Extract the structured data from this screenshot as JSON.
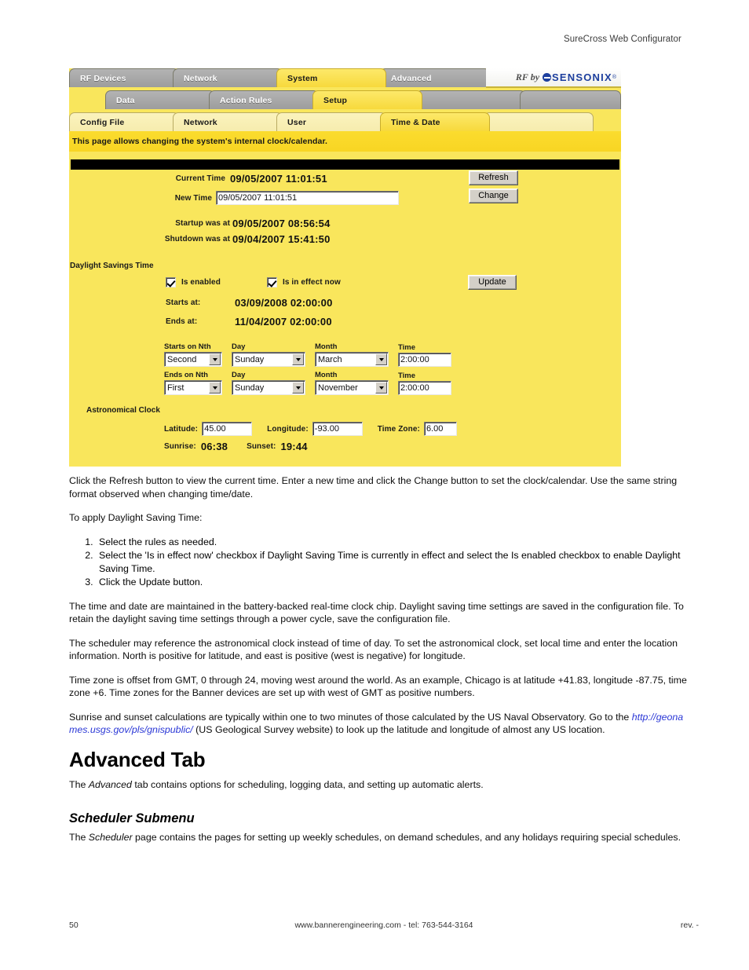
{
  "header": {
    "title": "SureCross Web Configurator"
  },
  "screenshot": {
    "tabs_row1": [
      {
        "label": "RF Devices",
        "state": "inactive"
      },
      {
        "label": "Network",
        "state": "inactive"
      },
      {
        "label": "System",
        "state": "active"
      },
      {
        "label": "Advanced",
        "state": "inactive"
      }
    ],
    "logo": {
      "rf_by": "RF by",
      "brand": "SENSONIX",
      "registered": "®"
    },
    "tabs_row2": [
      {
        "label": "Data",
        "state": "inactive"
      },
      {
        "label": "Action Rules",
        "state": "inactive"
      },
      {
        "label": "Setup",
        "state": "active"
      },
      {
        "label": "",
        "state": "inactive"
      },
      {
        "label": "",
        "state": "inactive"
      }
    ],
    "tabs_row3": [
      {
        "label": "Config File",
        "state": "pale"
      },
      {
        "label": "Network",
        "state": "pale"
      },
      {
        "label": "User",
        "state": "pale"
      },
      {
        "label": "Time & Date",
        "state": "active"
      },
      {
        "label": "",
        "state": "pale"
      }
    ],
    "description": "This page allows changing the system's internal clock/calendar.",
    "clock": {
      "current_time_label": "Current Time",
      "current_time_value": "09/05/2007 11:01:51",
      "new_time_label": "New Time",
      "new_time_value": "09/05/2007 11:01:51",
      "refresh_button": "Refresh",
      "change_button": "Change",
      "startup_label": "Startup was at",
      "startup_value": "09/05/2007 08:56:54",
      "shutdown_label": "Shutdown was at",
      "shutdown_value": "09/04/2007 15:41:50"
    },
    "dst": {
      "section_title": "Daylight Savings Time",
      "is_enabled_label": "Is enabled",
      "is_enabled_checked": true,
      "is_in_effect_label": "Is in effect now",
      "is_in_effect_checked": true,
      "update_button": "Update",
      "starts_at_label": "Starts at:",
      "starts_at_value": "03/09/2008 02:00:00",
      "ends_at_label": "Ends at:",
      "ends_at_value": "11/04/2007 02:00:00",
      "starts_row": {
        "nth_label": "Starts on Nth",
        "nth_value": "Second",
        "day_label": "Day",
        "day_value": "Sunday",
        "month_label": "Month",
        "month_value": "March",
        "time_label": "Time",
        "time_value": "2:00:00"
      },
      "ends_row": {
        "nth_label": "Ends on Nth",
        "nth_value": "First",
        "day_label": "Day",
        "day_value": "Sunday",
        "month_label": "Month",
        "month_value": "November",
        "time_label": "Time",
        "time_value": "2:00:00"
      }
    },
    "astro": {
      "section_title": "Astronomical Clock",
      "latitude_label": "Latitude:",
      "latitude_value": "45.00",
      "longitude_label": "Longitude:",
      "longitude_value": "-93.00",
      "timezone_label": "Time Zone:",
      "timezone_value": "6.00",
      "sunrise_label": "Sunrise:",
      "sunrise_value": "06:38",
      "sunset_label": "Sunset:",
      "sunset_value": "19:44"
    }
  },
  "prose": {
    "p1": "Click the Refresh button to view the current time. Enter a new time and click the Change button to set the clock/calendar. Use the same string format observed when changing time/date.",
    "p2": "To apply Daylight Saving Time:",
    "steps": [
      "Select the rules as needed.",
      "Select the 'Is in effect now' checkbox if Daylight Saving Time is currently in effect and select the Is enabled checkbox to enable Daylight Saving Time.",
      "Click the Update button."
    ],
    "p3": "The time and date are maintained in the battery-backed real-time clock chip. Daylight saving time settings are saved in the configuration file. To retain the daylight saving time settings through a power cycle, save the configuration file.",
    "p4": "The scheduler may reference the astronomical clock instead of time of day. To set the astronomical clock, set local time and enter the location information. North is positive for latitude, and east is positive (west is negative) for longitude.",
    "p5": "Time zone is offset from GMT, 0 through 24, moving west around the world. As an example, Chicago is at latitude +41.83, longitude -87.75, time zone +6. Time zones for the Banner devices are set up with west of GMT as positive numbers.",
    "p6_before": "Sunrise and sunset calculations are typically within one to two minutes of those calculated by the US Naval Observatory. Go to the ",
    "p6_link": "http://geonames.usgs.gov/pls/gnispublic/",
    "p6_after": " (US Geological Survey website) to look up the latitude and longitude of almost any US location.",
    "h_advanced": "Advanced Tab",
    "p_advanced_before": "The ",
    "p_advanced_em": "Advanced",
    "p_advanced_after": " tab contains options for scheduling, logging data, and setting up automatic alerts.",
    "h_scheduler": "Scheduler Submenu",
    "p_scheduler_before": "The ",
    "p_scheduler_em": "Scheduler",
    "p_scheduler_after": " page contains the pages for setting up weekly schedules, on demand schedules, and any holidays requiring special schedules."
  },
  "footer": {
    "page_number": "50",
    "center": "www.bannerengineering.com - tel: 763-544-3164",
    "revision": "rev. -"
  }
}
